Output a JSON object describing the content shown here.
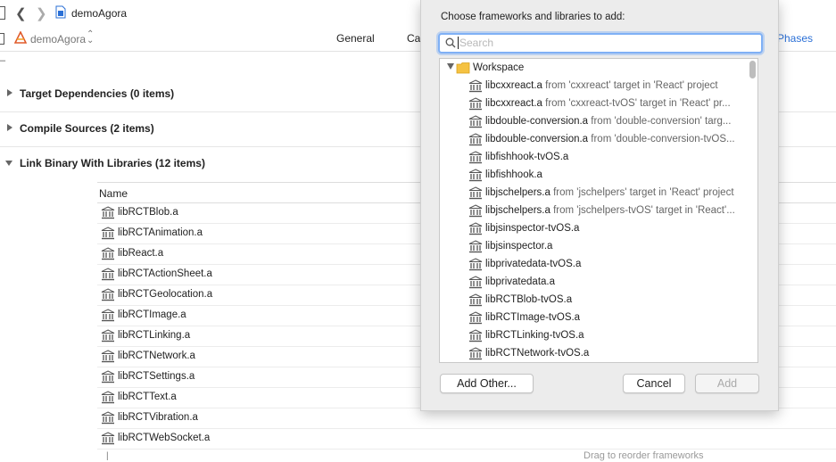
{
  "toolbar": {
    "project_name": "demoAgora"
  },
  "target_bar": {
    "target_name": "demoAgora",
    "tabs": [
      "General",
      "Ca",
      "Phases"
    ]
  },
  "phases": [
    {
      "title": "Target Dependencies (0 items)",
      "expanded": false
    },
    {
      "title": "Compile Sources (2 items)",
      "expanded": false
    },
    {
      "title": "Link Binary With Libraries (12 items)",
      "expanded": true
    }
  ],
  "libraries_table": {
    "header": "Name",
    "rows": [
      "libRCTBlob.a",
      "libRCTAnimation.a",
      "libReact.a",
      "libRCTActionSheet.a",
      "libRCTGeolocation.a",
      "libRCTImage.a",
      "libRCTLinking.a",
      "libRCTNetwork.a",
      "libRCTSettings.a",
      "libRCTText.a",
      "libRCTVibration.a",
      "libRCTWebSocket.a"
    ],
    "footer_hint": "Drag to reorder frameworks"
  },
  "dialog": {
    "title": "Choose frameworks and libraries to add:",
    "search_placeholder": "Search",
    "group_label": "Workspace",
    "items": [
      {
        "name": "libcxxreact.a",
        "desc": "from 'cxxreact' target in 'React' project"
      },
      {
        "name": "libcxxreact.a",
        "desc": "from 'cxxreact-tvOS' target in 'React' pr..."
      },
      {
        "name": "libdouble-conversion.a",
        "desc": "from 'double-conversion' targ..."
      },
      {
        "name": "libdouble-conversion.a",
        "desc": "from 'double-conversion-tvOS..."
      },
      {
        "name": "libfishhook-tvOS.a",
        "desc": ""
      },
      {
        "name": "libfishhook.a",
        "desc": ""
      },
      {
        "name": "libjschelpers.a",
        "desc": "from 'jschelpers' target in 'React' project"
      },
      {
        "name": "libjschelpers.a",
        "desc": "from 'jschelpers-tvOS' target in 'React'..."
      },
      {
        "name": "libjsinspector-tvOS.a",
        "desc": ""
      },
      {
        "name": "libjsinspector.a",
        "desc": ""
      },
      {
        "name": "libprivatedata-tvOS.a",
        "desc": ""
      },
      {
        "name": "libprivatedata.a",
        "desc": ""
      },
      {
        "name": "libRCTBlob-tvOS.a",
        "desc": ""
      },
      {
        "name": "libRCTImage-tvOS.a",
        "desc": ""
      },
      {
        "name": "libRCTLinking-tvOS.a",
        "desc": ""
      },
      {
        "name": "libRCTNetwork-tvOS.a",
        "desc": ""
      }
    ],
    "buttons": {
      "add_other": "Add Other...",
      "cancel": "Cancel",
      "add": "Add"
    }
  },
  "colors": {
    "accent": "#2a6fd6",
    "focus_ring": "#7fb0f5",
    "folder": "#f5c242"
  }
}
